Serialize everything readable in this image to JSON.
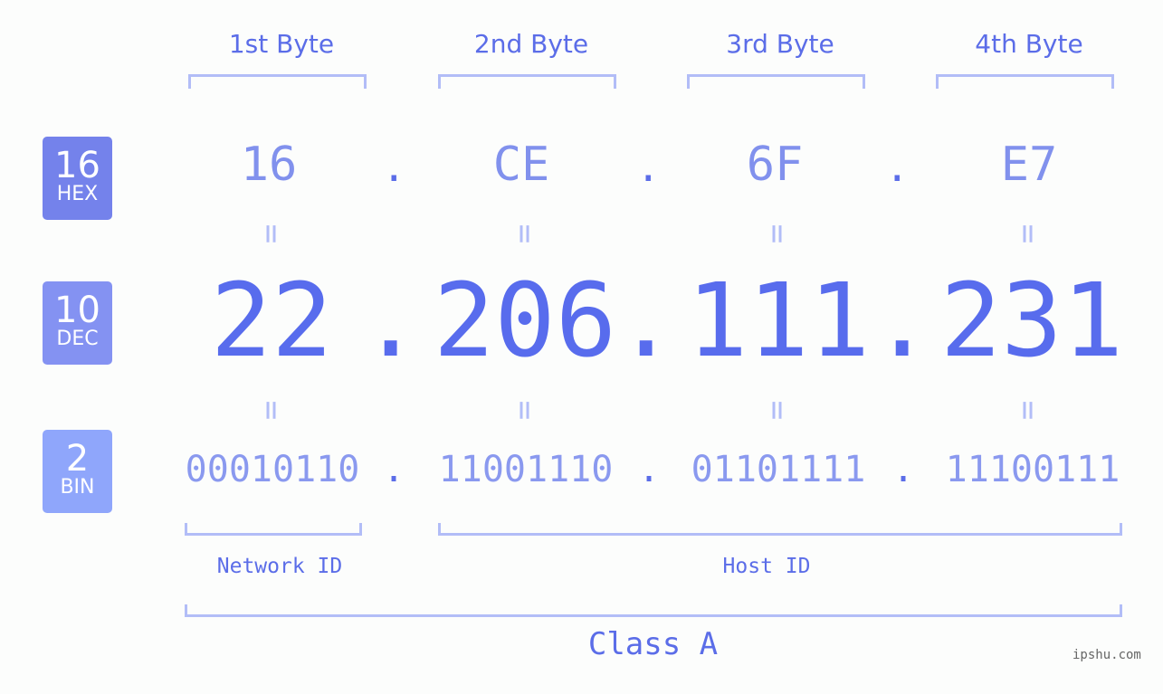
{
  "badges": [
    {
      "number": "16",
      "label": "HEX",
      "color": "#7482eb"
    },
    {
      "number": "10",
      "label": "DEC",
      "color": "#8492f2"
    },
    {
      "number": "2",
      "label": "BIN",
      "color": "#8fa6fb"
    }
  ],
  "byte_labels": [
    "1st Byte",
    "2nd Byte",
    "3rd Byte",
    "4th Byte"
  ],
  "hex": [
    "16",
    "CE",
    "6F",
    "E7"
  ],
  "dec": [
    "22",
    "206",
    "111",
    "231"
  ],
  "bin": [
    "00010110",
    "11001110",
    "01101111",
    "11100111"
  ],
  "separator": ".",
  "equals": "=",
  "network_id_label": "Network ID",
  "host_id_label": "Host ID",
  "class_label": "Class A",
  "watermark": "ipshu.com",
  "colors": {
    "accent": "#586ced",
    "light": "#b2bdf7"
  }
}
